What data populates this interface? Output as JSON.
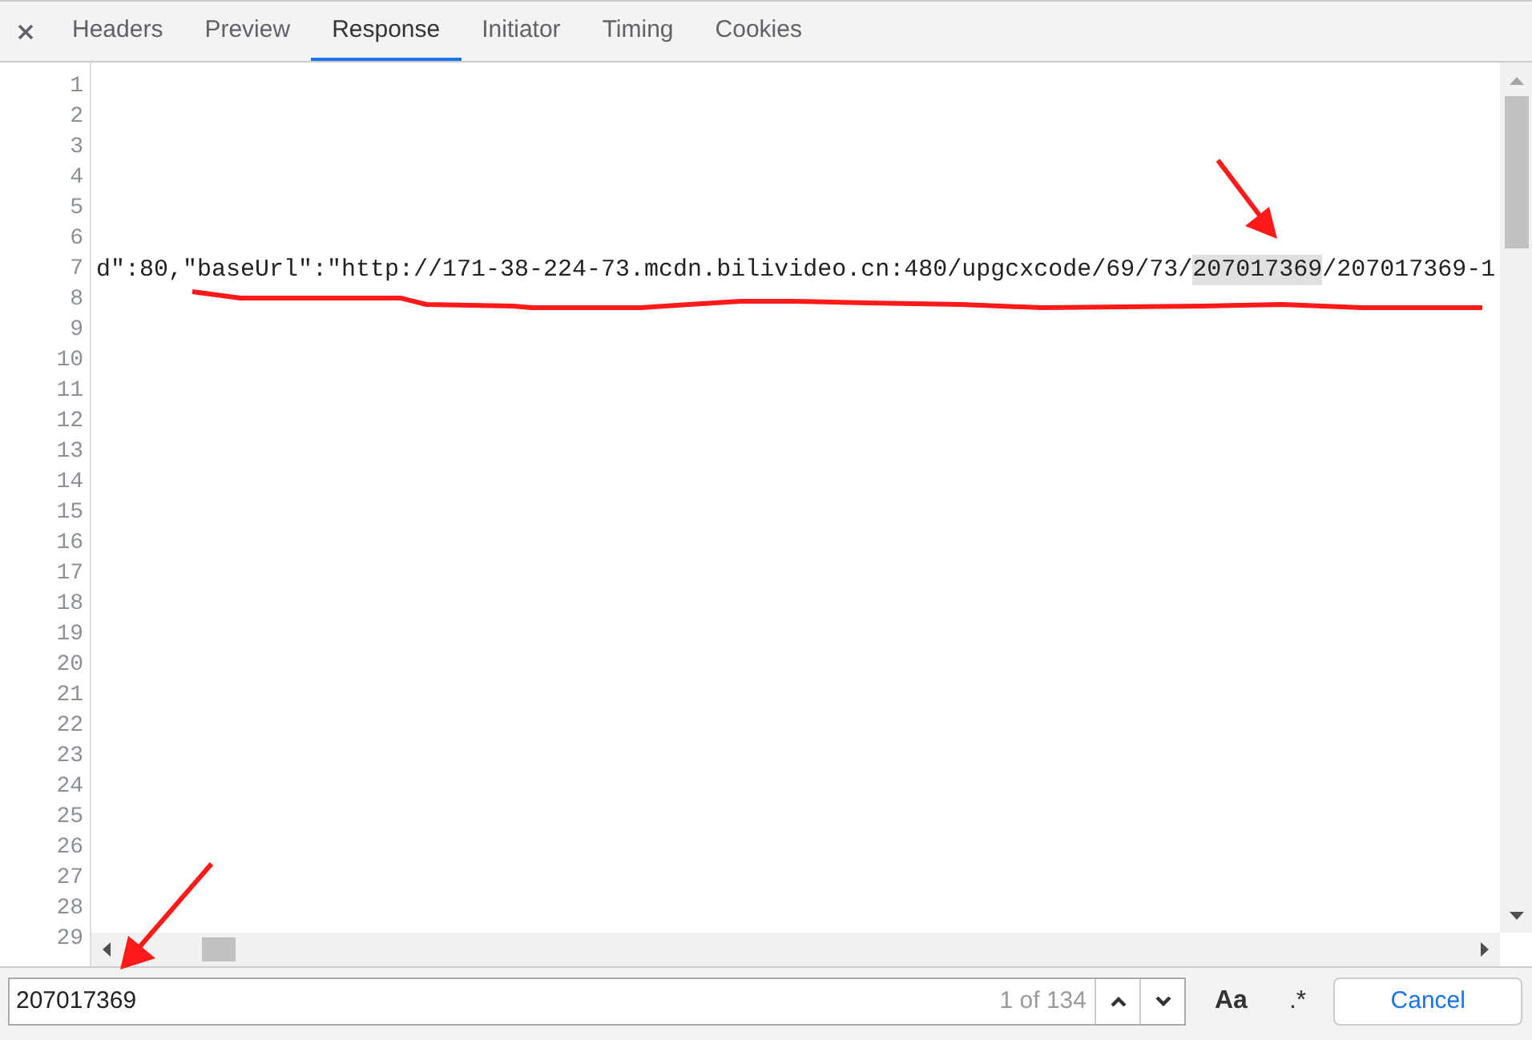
{
  "tabs": [
    {
      "label": "Headers",
      "selected": false
    },
    {
      "label": "Preview",
      "selected": false
    },
    {
      "label": "Response",
      "selected": true
    },
    {
      "label": "Initiator",
      "selected": false
    },
    {
      "label": "Timing",
      "selected": false
    },
    {
      "label": "Cookies",
      "selected": false
    }
  ],
  "editor": {
    "lines": [
      {
        "number": "1"
      },
      {
        "number": "2"
      },
      {
        "number": "3"
      },
      {
        "number": "4"
      },
      {
        "number": "5"
      },
      {
        "number": "6"
      },
      {
        "number": "7",
        "code": [
          {
            "text": "d\":80,\"baseUrl\":\"http://171-38-224-73.mcdn.bilivideo.cn:480/upgcxcode/69/73/",
            "highlighted": false
          },
          {
            "text": "207017369",
            "highlighted": true
          },
          {
            "text": "/207017369-1",
            "highlighted": false
          }
        ]
      },
      {
        "number": "8"
      },
      {
        "number": "9"
      },
      {
        "number": "10"
      },
      {
        "number": "11"
      },
      {
        "number": "12"
      },
      {
        "number": "13"
      },
      {
        "number": "14"
      },
      {
        "number": "15"
      },
      {
        "number": "16"
      },
      {
        "number": "17"
      },
      {
        "number": "18"
      },
      {
        "number": "19"
      },
      {
        "number": "20"
      },
      {
        "number": "21"
      },
      {
        "number": "22"
      },
      {
        "number": "23"
      },
      {
        "number": "24"
      },
      {
        "number": "25"
      },
      {
        "number": "26"
      },
      {
        "number": "27"
      },
      {
        "number": "28"
      },
      {
        "number": "29"
      }
    ]
  },
  "search": {
    "value": "207017369",
    "match_count": "1 of 134",
    "match_case_button": "Aa",
    "regex_button": ".*",
    "cancel_button": "Cancel"
  }
}
